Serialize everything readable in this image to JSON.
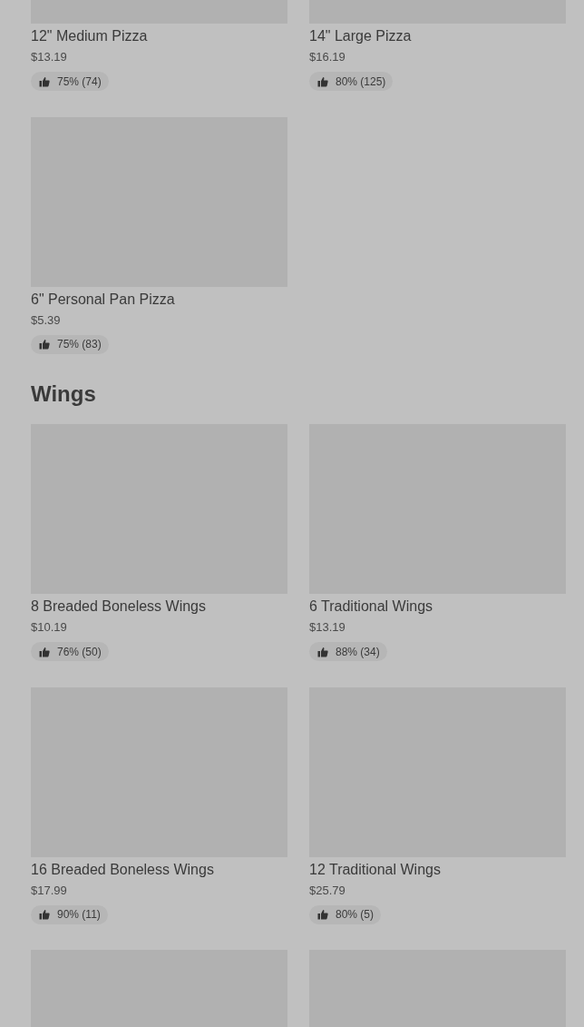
{
  "sections": [
    {
      "items": [
        {
          "kind": "product",
          "name": "12\" Medium Pizza",
          "price": "$13.19",
          "rating": "75% (74)"
        },
        {
          "kind": "product",
          "name": "14\" Large Pizza",
          "price": "$16.19",
          "rating": "80% (125)"
        },
        {
          "kind": "product",
          "name": "6\" Personal Pan Pizza",
          "price": "$5.39",
          "rating": "75% (83)"
        }
      ]
    },
    {
      "heading": "Wings",
      "items": [
        {
          "kind": "product",
          "name": "8 Breaded Boneless Wings",
          "price": "$10.19",
          "rating": "76% (50)"
        },
        {
          "kind": "product",
          "name": "6 Traditional Wings",
          "price": "$13.19",
          "rating": "88% (34)"
        },
        {
          "kind": "product",
          "name": "16 Breaded Boneless Wings",
          "price": "$17.99",
          "rating": "90% (11)"
        },
        {
          "kind": "product",
          "name": "12 Traditional Wings",
          "price": "$25.79",
          "rating": "80% (5)"
        },
        {
          "kind": "picture"
        },
        {
          "kind": "picture"
        }
      ]
    }
  ]
}
